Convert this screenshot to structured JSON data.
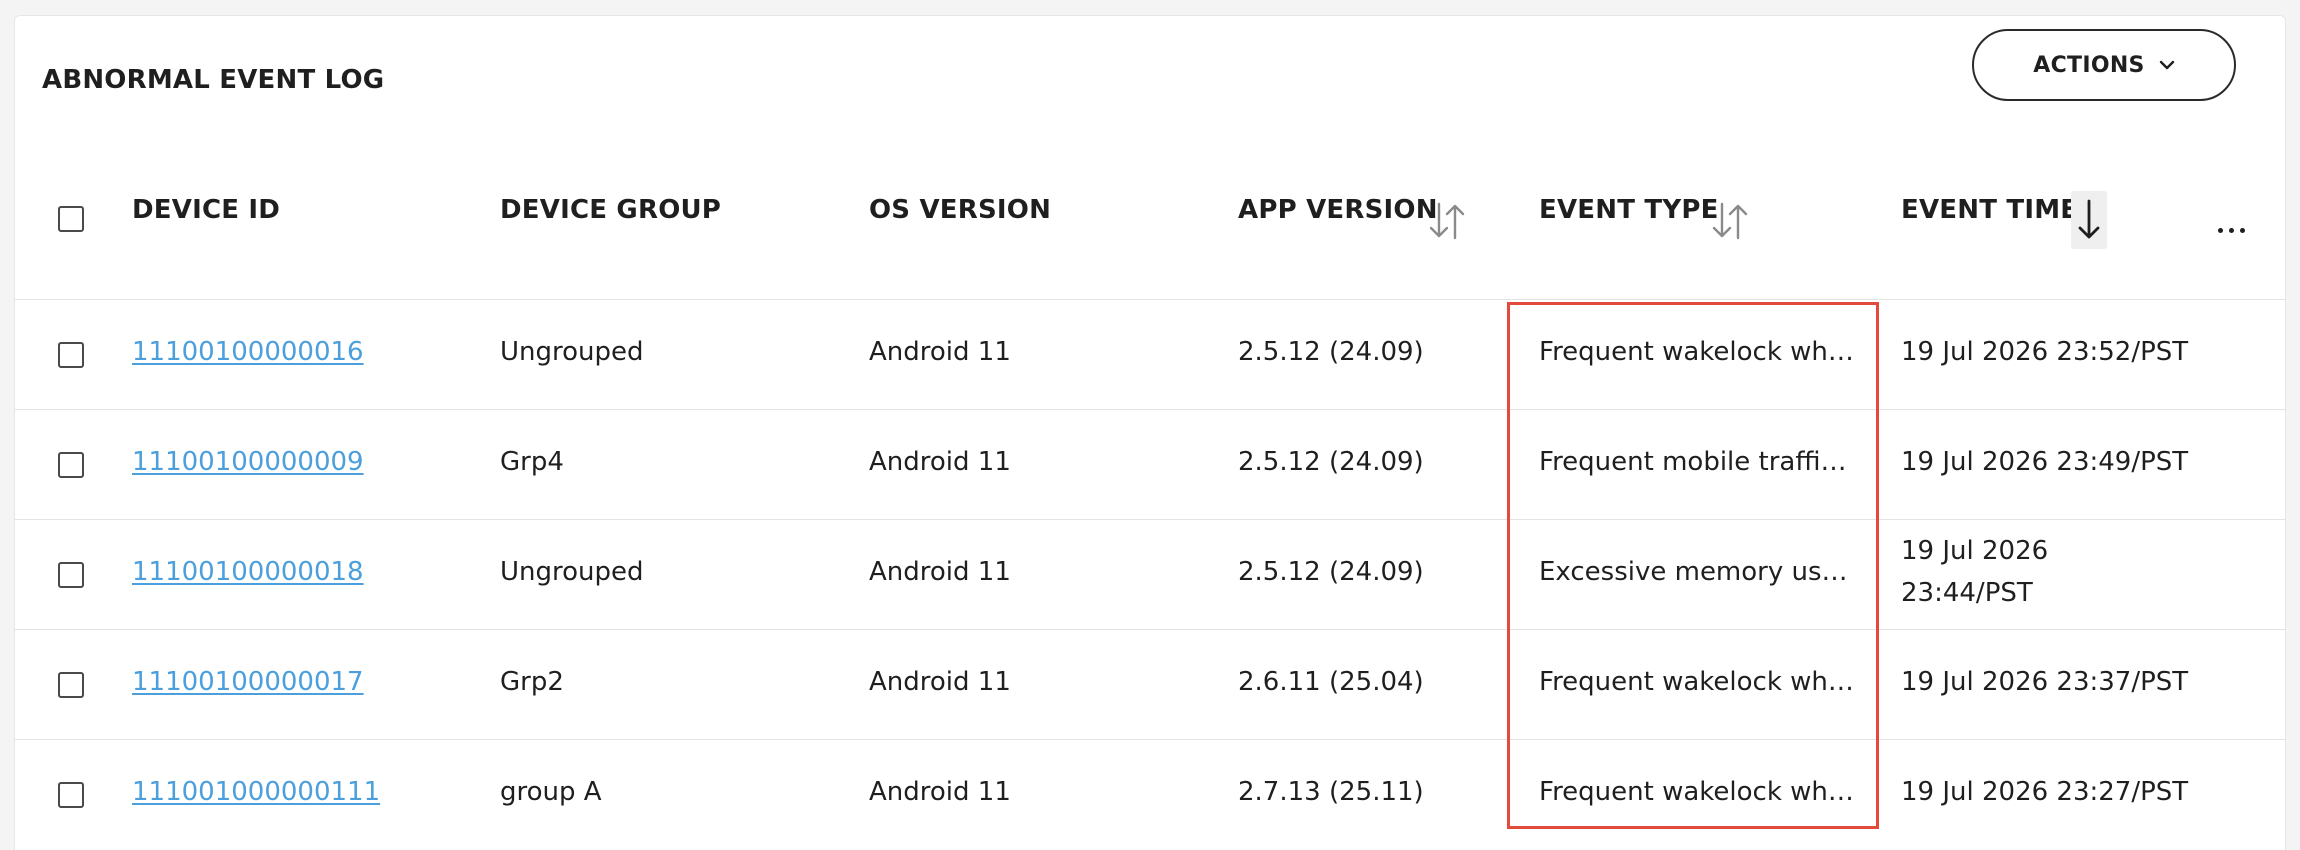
{
  "panel": {
    "title": "ABNORMAL EVENT LOG"
  },
  "toolbar": {
    "actions_label": "ACTIONS",
    "actions_icon": "chevron-down-icon"
  },
  "table": {
    "columns": {
      "device_id": "DEVICE ID",
      "device_group": "DEVICE GROUP",
      "os_version": "OS VERSION",
      "app_version": "APP VERSION",
      "event_type": "EVENT TYPE",
      "event_time": "EVENT TIME"
    },
    "sort": {
      "active_column": "event_time",
      "direction": "descending"
    },
    "rows": [
      {
        "device_id": "11100100000016",
        "device_group": "Ungrouped",
        "os_version": "Android 11",
        "app_version": "2.5.12 (24.09)",
        "event_type": "Frequent wakelock when screen off",
        "event_time": "19 Jul 2026 23:52/PST"
      },
      {
        "device_id": "11100100000009",
        "device_group": "Grp4",
        "os_version": "Android 11",
        "app_version": "2.5.12 (24.09)",
        "event_type": "Frequent mobile traffic usage",
        "event_time": "19 Jul 2026 23:49/PST"
      },
      {
        "device_id": "11100100000018",
        "device_group": "Ungrouped",
        "os_version": "Android 11",
        "app_version": "2.5.12 (24.09)",
        "event_type": "Excessive memory usage",
        "event_time": "19 Jul 2026 23:44/PST"
      },
      {
        "device_id": "11100100000017",
        "device_group": "Grp2",
        "os_version": "Android 11",
        "app_version": "2.6.11 (25.04)",
        "event_type": "Frequent wakelock when screen off",
        "event_time": "19 Jul 2026 23:37/PST"
      },
      {
        "device_id": "111001000000111",
        "device_group": "group A",
        "os_version": "Android 11",
        "app_version": "2.7.13 (25.11)",
        "event_type": "Frequent wakelock when screen off",
        "event_time": "19 Jul 2026 23:27/PST"
      }
    ]
  },
  "colors": {
    "link": "#4a9fdc",
    "highlight": "#e24a3b",
    "divider": "#e3e3e3"
  }
}
